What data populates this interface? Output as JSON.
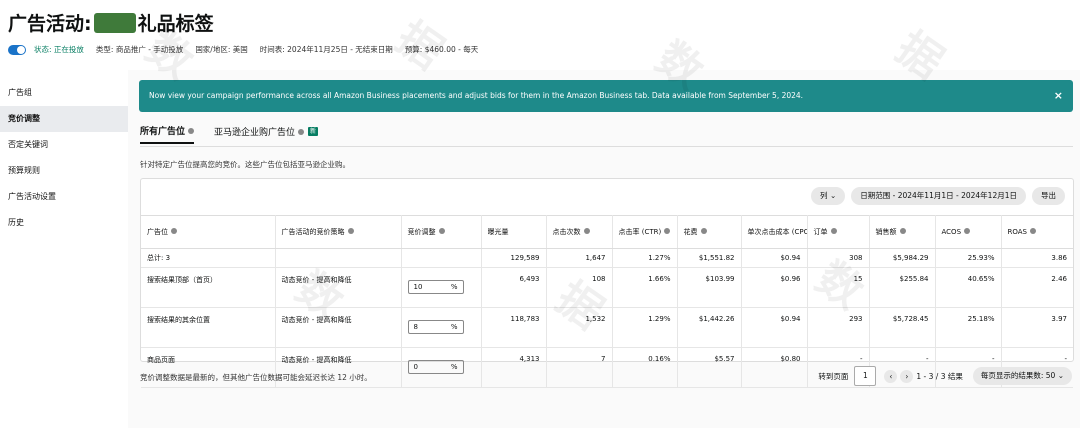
{
  "header": {
    "title_prefix": "广告活动:",
    "title_suffix": "礼品标签",
    "status": "状态: 正在投放",
    "type": "类型: 商品推广 - 手动投放",
    "region": "国家/地区: 美国",
    "schedule": "时间表: 2024年11月25日 - 无结束日期",
    "budget": "预算: $460.00 - 每天"
  },
  "sidebar": {
    "items": [
      {
        "label": "广告组"
      },
      {
        "label": "竞价调整"
      },
      {
        "label": "否定关键词"
      },
      {
        "label": "预算规则"
      },
      {
        "label": "广告活动设置"
      },
      {
        "label": "历史"
      }
    ]
  },
  "banner": {
    "text": "Now view your campaign performance across all Amazon Business placements and adjust bids for them in the Amazon Business tab. Data available from September 5, 2024.",
    "close": "×"
  },
  "tabs": [
    {
      "label": "所有广告位"
    },
    {
      "label": "亚马逊企业购广告位",
      "badge": "新"
    }
  ],
  "description": "针对特定广告位提高您的竞价。这些广告位包括亚马逊企业购。",
  "toolbar": {
    "columns": "列",
    "date_range": "日期范围 - 2024年11月1日 - 2024年12月1日",
    "export": "导出"
  },
  "table": {
    "headers": [
      "广告位",
      "广告活动的竞价策略",
      "竞价调整",
      "曝光量",
      "点击次数",
      "点击率 (CTR)",
      "花费",
      "单次点击成本 (CPC)",
      "订单",
      "销售额",
      "ACOS",
      "ROAS"
    ],
    "total": {
      "label": "总计: 3",
      "impressions": "129,589",
      "clicks": "1,647",
      "ctr": "1.27%",
      "spend": "$1,551.82",
      "cpc": "$0.94",
      "orders": "308",
      "sales": "$5,984.29",
      "acos": "25.93%",
      "roas": "3.86"
    },
    "rows": [
      {
        "placement": "搜索结果顶部（首页）",
        "strategy": "动态竞价 - 提高和降低",
        "bid": "10",
        "unit": "%",
        "impressions": "6,493",
        "clicks": "108",
        "ctr": "1.66%",
        "spend": "$103.99",
        "cpc": "$0.96",
        "orders": "15",
        "sales": "$255.84",
        "acos": "40.65%",
        "roas": "2.46"
      },
      {
        "placement": "搜索结果的其余位置",
        "strategy": "动态竞价 - 提高和降低",
        "bid": "8",
        "unit": "%",
        "impressions": "118,783",
        "clicks": "1,532",
        "ctr": "1.29%",
        "spend": "$1,442.26",
        "cpc": "$0.94",
        "orders": "293",
        "sales": "$5,728.45",
        "acos": "25.18%",
        "roas": "3.97"
      },
      {
        "placement": "商品页面",
        "strategy": "动态竞价 - 提高和降低",
        "bid": "0",
        "unit": "%",
        "impressions": "4,313",
        "clicks": "7",
        "ctr": "0.16%",
        "spend": "$5.57",
        "cpc": "$0.80",
        "orders": "-",
        "sales": "-",
        "acos": "-",
        "roas": "-"
      }
    ]
  },
  "footer": {
    "note": "竞价调整数据是最新的，但其他广告位数据可能会延迟长达 12 小时。",
    "goto": "转到页面",
    "page": "1",
    "prev": "‹",
    "next": "›",
    "range": "1 - 3 / 3 结果",
    "per_page": "每页显示的结果数: 50"
  },
  "colors": {
    "banner": "#1e8a8a",
    "toggle": "#1a73c8",
    "status_green": "#067d62"
  }
}
